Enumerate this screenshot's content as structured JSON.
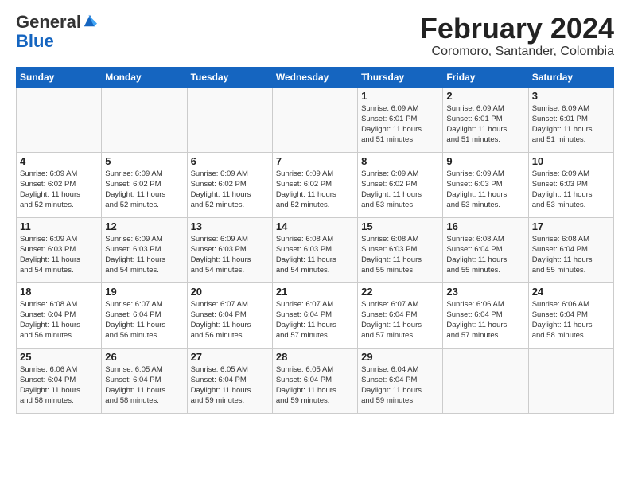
{
  "logo": {
    "general": "General",
    "blue": "Blue"
  },
  "title": "February 2024",
  "subtitle": "Coromoro, Santander, Colombia",
  "days_of_week": [
    "Sunday",
    "Monday",
    "Tuesday",
    "Wednesday",
    "Thursday",
    "Friday",
    "Saturday"
  ],
  "weeks": [
    [
      {
        "day": "",
        "info": ""
      },
      {
        "day": "",
        "info": ""
      },
      {
        "day": "",
        "info": ""
      },
      {
        "day": "",
        "info": ""
      },
      {
        "day": "1",
        "info": "Sunrise: 6:09 AM\nSunset: 6:01 PM\nDaylight: 11 hours\nand 51 minutes."
      },
      {
        "day": "2",
        "info": "Sunrise: 6:09 AM\nSunset: 6:01 PM\nDaylight: 11 hours\nand 51 minutes."
      },
      {
        "day": "3",
        "info": "Sunrise: 6:09 AM\nSunset: 6:01 PM\nDaylight: 11 hours\nand 51 minutes."
      }
    ],
    [
      {
        "day": "4",
        "info": "Sunrise: 6:09 AM\nSunset: 6:02 PM\nDaylight: 11 hours\nand 52 minutes."
      },
      {
        "day": "5",
        "info": "Sunrise: 6:09 AM\nSunset: 6:02 PM\nDaylight: 11 hours\nand 52 minutes."
      },
      {
        "day": "6",
        "info": "Sunrise: 6:09 AM\nSunset: 6:02 PM\nDaylight: 11 hours\nand 52 minutes."
      },
      {
        "day": "7",
        "info": "Sunrise: 6:09 AM\nSunset: 6:02 PM\nDaylight: 11 hours\nand 52 minutes."
      },
      {
        "day": "8",
        "info": "Sunrise: 6:09 AM\nSunset: 6:02 PM\nDaylight: 11 hours\nand 53 minutes."
      },
      {
        "day": "9",
        "info": "Sunrise: 6:09 AM\nSunset: 6:03 PM\nDaylight: 11 hours\nand 53 minutes."
      },
      {
        "day": "10",
        "info": "Sunrise: 6:09 AM\nSunset: 6:03 PM\nDaylight: 11 hours\nand 53 minutes."
      }
    ],
    [
      {
        "day": "11",
        "info": "Sunrise: 6:09 AM\nSunset: 6:03 PM\nDaylight: 11 hours\nand 54 minutes."
      },
      {
        "day": "12",
        "info": "Sunrise: 6:09 AM\nSunset: 6:03 PM\nDaylight: 11 hours\nand 54 minutes."
      },
      {
        "day": "13",
        "info": "Sunrise: 6:09 AM\nSunset: 6:03 PM\nDaylight: 11 hours\nand 54 minutes."
      },
      {
        "day": "14",
        "info": "Sunrise: 6:08 AM\nSunset: 6:03 PM\nDaylight: 11 hours\nand 54 minutes."
      },
      {
        "day": "15",
        "info": "Sunrise: 6:08 AM\nSunset: 6:03 PM\nDaylight: 11 hours\nand 55 minutes."
      },
      {
        "day": "16",
        "info": "Sunrise: 6:08 AM\nSunset: 6:04 PM\nDaylight: 11 hours\nand 55 minutes."
      },
      {
        "day": "17",
        "info": "Sunrise: 6:08 AM\nSunset: 6:04 PM\nDaylight: 11 hours\nand 55 minutes."
      }
    ],
    [
      {
        "day": "18",
        "info": "Sunrise: 6:08 AM\nSunset: 6:04 PM\nDaylight: 11 hours\nand 56 minutes."
      },
      {
        "day": "19",
        "info": "Sunrise: 6:07 AM\nSunset: 6:04 PM\nDaylight: 11 hours\nand 56 minutes."
      },
      {
        "day": "20",
        "info": "Sunrise: 6:07 AM\nSunset: 6:04 PM\nDaylight: 11 hours\nand 56 minutes."
      },
      {
        "day": "21",
        "info": "Sunrise: 6:07 AM\nSunset: 6:04 PM\nDaylight: 11 hours\nand 57 minutes."
      },
      {
        "day": "22",
        "info": "Sunrise: 6:07 AM\nSunset: 6:04 PM\nDaylight: 11 hours\nand 57 minutes."
      },
      {
        "day": "23",
        "info": "Sunrise: 6:06 AM\nSunset: 6:04 PM\nDaylight: 11 hours\nand 57 minutes."
      },
      {
        "day": "24",
        "info": "Sunrise: 6:06 AM\nSunset: 6:04 PM\nDaylight: 11 hours\nand 58 minutes."
      }
    ],
    [
      {
        "day": "25",
        "info": "Sunrise: 6:06 AM\nSunset: 6:04 PM\nDaylight: 11 hours\nand 58 minutes."
      },
      {
        "day": "26",
        "info": "Sunrise: 6:05 AM\nSunset: 6:04 PM\nDaylight: 11 hours\nand 58 minutes."
      },
      {
        "day": "27",
        "info": "Sunrise: 6:05 AM\nSunset: 6:04 PM\nDaylight: 11 hours\nand 59 minutes."
      },
      {
        "day": "28",
        "info": "Sunrise: 6:05 AM\nSunset: 6:04 PM\nDaylight: 11 hours\nand 59 minutes."
      },
      {
        "day": "29",
        "info": "Sunrise: 6:04 AM\nSunset: 6:04 PM\nDaylight: 11 hours\nand 59 minutes."
      },
      {
        "day": "",
        "info": ""
      },
      {
        "day": "",
        "info": ""
      }
    ]
  ]
}
